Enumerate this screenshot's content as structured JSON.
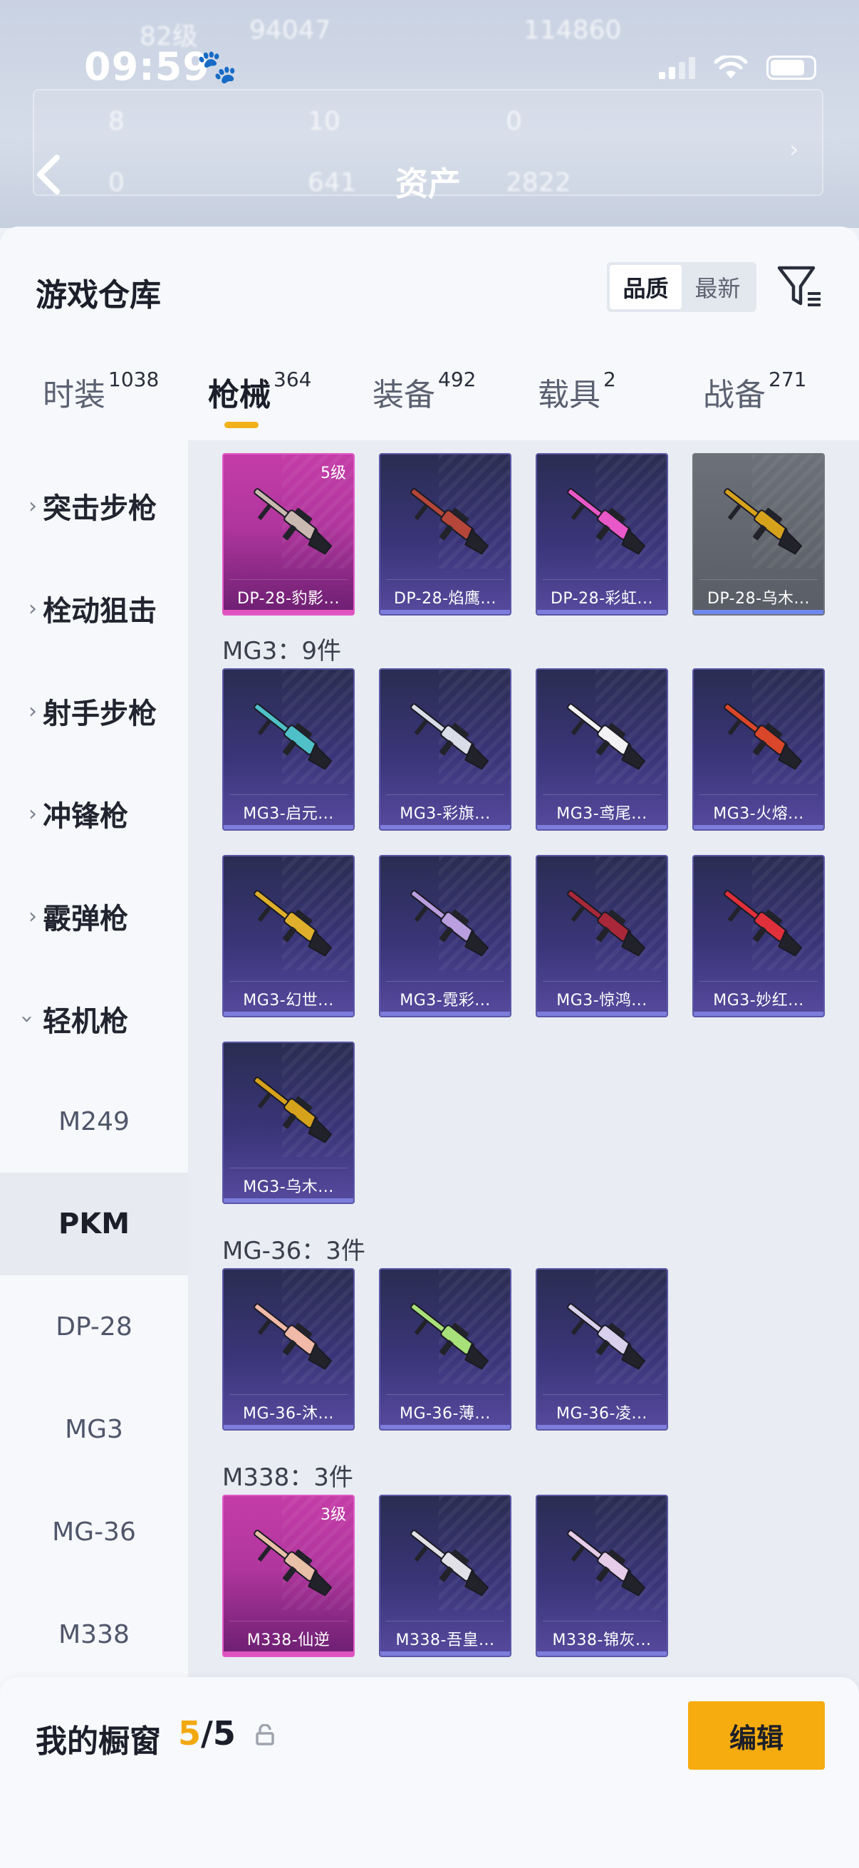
{
  "status_bar": {
    "time": "09:59"
  },
  "background_header": {
    "title": "资产",
    "row1": [
      "82级",
      "94047",
      "114860"
    ],
    "row2": [
      "8",
      "10",
      "0"
    ],
    "row3": [
      "0",
      "641",
      "2822"
    ]
  },
  "header": {
    "title": "游戏仓库",
    "sort_options": [
      "品质",
      "最新"
    ],
    "active_sort": "品质"
  },
  "tabs": [
    {
      "label": "时装",
      "count": "1038"
    },
    {
      "label": "枪械",
      "count": "364"
    },
    {
      "label": "装备",
      "count": "492"
    },
    {
      "label": "载具",
      "count": "2"
    },
    {
      "label": "战备",
      "count": "271"
    }
  ],
  "active_tab": "枪械",
  "sidebar": {
    "categories": [
      "突击步枪",
      "栓动狙击",
      "射手步枪",
      "冲锋枪",
      "霰弹枪",
      "轻机枪"
    ],
    "subcategories": [
      "M249",
      "PKM",
      "DP-28",
      "MG3",
      "MG-36",
      "M338"
    ],
    "selected_subcategory": "PKM"
  },
  "groups": [
    {
      "title": "",
      "items": [
        {
          "name": "DP-28-豹影...",
          "level": "5级",
          "rarity": "pink",
          "gun_color": "#c9b9b0"
        },
        {
          "name": "DP-28-焰鹰...",
          "level": "",
          "rarity": "purple",
          "gun_color": "#b5463a"
        },
        {
          "name": "DP-28-彩虹...",
          "level": "",
          "rarity": "purple",
          "gun_color": "#e858c8"
        },
        {
          "name": "DP-28-乌木...",
          "level": "",
          "rarity": "grey",
          "gun_color": "#d6a21c"
        }
      ]
    },
    {
      "title": "MG3：9件",
      "items": [
        {
          "name": "MG3-启元...",
          "level": "",
          "rarity": "purple",
          "gun_color": "#4fc0c8"
        },
        {
          "name": "MG3-彩旗...",
          "level": "",
          "rarity": "purple",
          "gun_color": "#d9dde8"
        },
        {
          "name": "MG3-鸢尾...",
          "level": "",
          "rarity": "purple",
          "gun_color": "#f2f2f4"
        },
        {
          "name": "MG3-火熔...",
          "level": "",
          "rarity": "purple",
          "gun_color": "#d9462a"
        },
        {
          "name": "MG3-幻世...",
          "level": "",
          "rarity": "purple",
          "gun_color": "#e0b02c"
        },
        {
          "name": "MG3-霓彩...",
          "level": "",
          "rarity": "purple",
          "gun_color": "#b99ee0"
        },
        {
          "name": "MG3-惊鸿...",
          "level": "",
          "rarity": "purple",
          "gun_color": "#a8283a"
        },
        {
          "name": "MG3-妙红...",
          "level": "",
          "rarity": "purple",
          "gun_color": "#e0303c"
        },
        {
          "name": "MG3-乌木...",
          "level": "",
          "rarity": "purple",
          "gun_color": "#d6a21c"
        }
      ]
    },
    {
      "title": "MG-36：3件",
      "items": [
        {
          "name": "MG-36-沐...",
          "level": "",
          "rarity": "purple",
          "gun_color": "#f0b9a8"
        },
        {
          "name": "MG-36-薄...",
          "level": "",
          "rarity": "purple",
          "gun_color": "#a8e07a"
        },
        {
          "name": "MG-36-凌...",
          "level": "",
          "rarity": "purple",
          "gun_color": "#d8d0ec"
        }
      ]
    },
    {
      "title": "M338：3件",
      "items": [
        {
          "name": "M338-仙逆",
          "level": "3级",
          "rarity": "pink",
          "gun_color": "#e8c0a8"
        },
        {
          "name": "M338-吾皇...",
          "level": "",
          "rarity": "purple",
          "gun_color": "#e0e0e6"
        },
        {
          "name": "M338-锦灰...",
          "level": "",
          "rarity": "purple",
          "gun_color": "#e6cce8"
        }
      ]
    }
  ],
  "showcase": {
    "label": "我的橱窗",
    "current": "5",
    "separator": "/",
    "total": "5",
    "edit_label": "编辑"
  },
  "colors": {
    "accent": "#f2b11a",
    "edit_button": "#f6ab0f",
    "pink_rarity": "#c43ca7",
    "purple_rarity": "#3a3579",
    "grey_rarity": "#595d66"
  },
  "icons": [
    "back-chevron-icon",
    "filter-icon",
    "chevron-right-icon",
    "chevron-down-icon",
    "share-icon",
    "lock-icon",
    "paw-icon",
    "signal-icon",
    "wifi-icon",
    "battery-icon"
  ]
}
